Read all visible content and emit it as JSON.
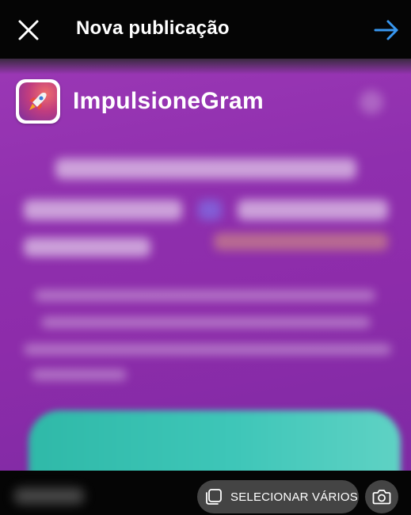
{
  "header": {
    "title": "Nova publicação",
    "close_icon": "close-icon",
    "next_icon": "arrow-right-icon",
    "accent_color": "#3897f0"
  },
  "preview": {
    "brand_name": "ImpulsioneGram",
    "logo_icon": "rocket-icon",
    "background_color": "#8f2fae",
    "cta_color": "#3ec6b8",
    "expand_icon": "expand-icon"
  },
  "bottom_bar": {
    "select_multiple_label": "SELECIONAR VÁRIOS",
    "select_multiple_icon": "multi-select-icon",
    "camera_icon": "camera-icon"
  }
}
